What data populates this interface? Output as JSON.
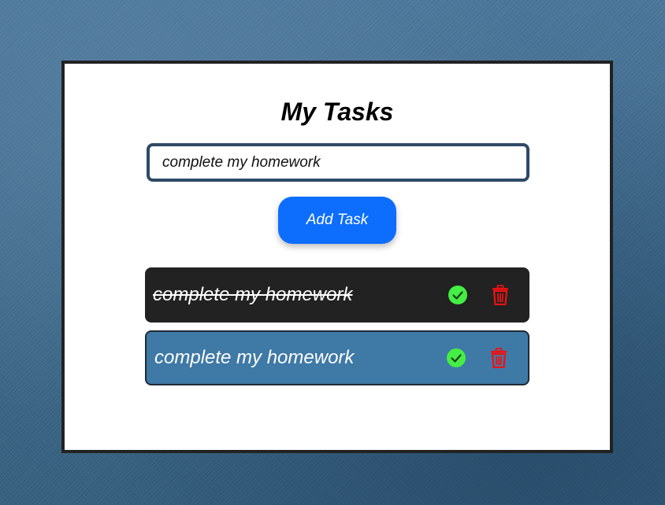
{
  "app": {
    "title": "My Tasks"
  },
  "input": {
    "value": "complete my homework"
  },
  "add_button": {
    "label": "Add Task"
  },
  "tasks": [
    {
      "text": "complete my homework",
      "completed": true
    },
    {
      "text": "complete my homework",
      "completed": false
    }
  ],
  "icons": {
    "complete": "check-circle-icon",
    "delete": "trash-icon"
  },
  "colors": {
    "accent": "#0d6efd",
    "check": "#44ee44",
    "delete": "#ee1111",
    "completed_task_bg": "#222222",
    "pending_task_bg": "#3f79a6"
  }
}
